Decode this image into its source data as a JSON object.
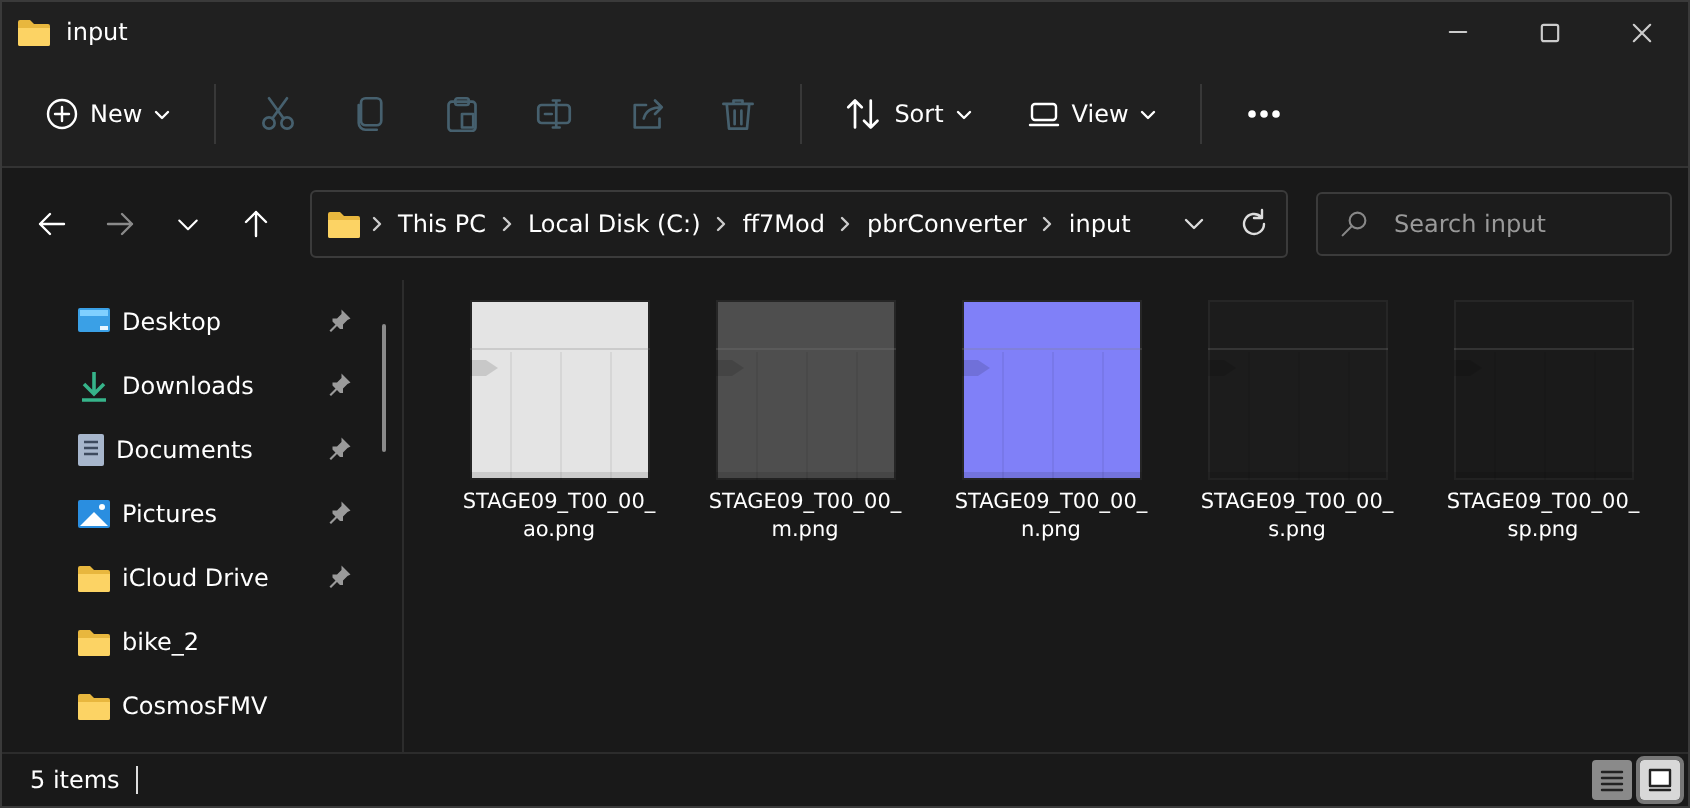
{
  "window": {
    "title": "input"
  },
  "toolbar": [
    {
      "kind": "new",
      "label": "New",
      "disabled": false
    },
    {
      "kind": "cut",
      "disabled": true
    },
    {
      "kind": "copy",
      "disabled": true
    },
    {
      "kind": "paste",
      "disabled": true
    },
    {
      "kind": "rename",
      "disabled": true
    },
    {
      "kind": "share",
      "disabled": true
    },
    {
      "kind": "delete",
      "disabled": true
    },
    {
      "kind": "sort",
      "label": "Sort",
      "disabled": false
    },
    {
      "kind": "view",
      "label": "View",
      "disabled": false
    },
    {
      "kind": "more",
      "disabled": false
    }
  ],
  "nav": [
    {
      "kind": "back",
      "disabled": false
    },
    {
      "kind": "forward",
      "disabled": true
    },
    {
      "kind": "recent",
      "disabled": false
    },
    {
      "kind": "up",
      "disabled": false
    }
  ],
  "breadcrumb": [
    "This PC",
    "Local Disk (C:)",
    "ff7Mod",
    "pbrConverter",
    "input"
  ],
  "search": {
    "placeholder": "Search input"
  },
  "sidebar": {
    "items": [
      {
        "kind": "desktop",
        "label": "Desktop",
        "pinned": true
      },
      {
        "kind": "downloads",
        "label": "Downloads",
        "pinned": true
      },
      {
        "kind": "documents",
        "label": "Documents",
        "pinned": true
      },
      {
        "kind": "pictures",
        "label": "Pictures",
        "pinned": true
      },
      {
        "kind": "folder",
        "label": "iCloud Drive",
        "pinned": true
      },
      {
        "kind": "folder",
        "label": "bike_2",
        "pinned": false
      },
      {
        "kind": "folder",
        "label": "CosmosFMV",
        "pinned": false
      }
    ]
  },
  "files": [
    {
      "name": "STAGE09_T00_00_ao.png",
      "color": "#e4e4e4"
    },
    {
      "name": "STAGE09_T00_00_m.png",
      "color": "#4e4e4e"
    },
    {
      "name": "STAGE09_T00_00_n.png",
      "color": "#8080f8"
    },
    {
      "name": "STAGE09_T00_00_s.png",
      "color": "#1c1c1c"
    },
    {
      "name": "STAGE09_T00_00_sp.png",
      "color": "#1a1a1a"
    }
  ],
  "status_bar": {
    "count": "5 items",
    "views": [
      {
        "kind": "details",
        "selected": false
      },
      {
        "kind": "tiles",
        "selected": true
      }
    ]
  }
}
